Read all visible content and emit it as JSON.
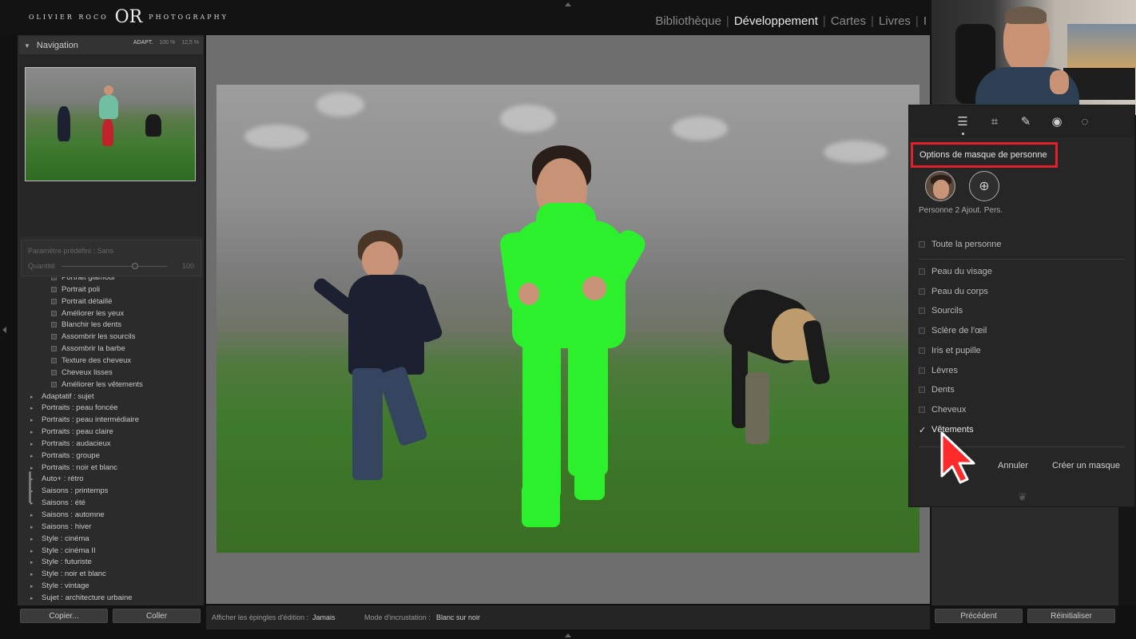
{
  "header": {
    "logo_left": "OLIVIER ROCO",
    "logo_monogram": "OR",
    "logo_right": "PHOTOGRAPHY",
    "modules": [
      {
        "label": "Bibliothèque",
        "active": false
      },
      {
        "label": "Développement",
        "active": true
      },
      {
        "label": "Cartes",
        "active": false
      },
      {
        "label": "Livres",
        "active": false
      },
      {
        "label": "I",
        "active": false
      }
    ],
    "separator": "|"
  },
  "navigator": {
    "title": "Navigation",
    "zoom_options": [
      "ADAPT.",
      "100 %",
      "12,5 %"
    ]
  },
  "preset_panel": {
    "preset_label": "Paramètre prédéfini : Sans",
    "amount_label": "Quantité",
    "amount_value": "100",
    "amount_fraction": 0.7
  },
  "preset_items": [
    "Portrait glamour",
    "Portrait poli",
    "Portrait détaillé",
    "Améliorer les yeux",
    "Blanchir les dents",
    "Assombrir les sourcils",
    "Assombrir la barbe",
    "Texture des cheveux",
    "Cheveux lisses",
    "Améliorer les vêtements"
  ],
  "preset_groups": [
    "Adaptatif : sujet",
    "Portraits : peau foncée",
    "Portraits : peau intermédiaire",
    "Portraits : peau claire",
    "Portraits : audacieux",
    "Portraits : groupe",
    "Portraits : noir et blanc",
    "Auto+ : rétro",
    "Saisons : printemps",
    "Saisons : été",
    "Saisons : automne",
    "Saisons : hiver",
    "Style : cinéma",
    "Style : cinéma II",
    "Style : futuriste",
    "Style : noir et blanc",
    "Style : vintage",
    "Sujet : architecture urbaine"
  ],
  "left_buttons": {
    "copy": "Copier...",
    "paste": "Coller"
  },
  "toolbar": {
    "pins_label": "Afficher les épingles d'édition :",
    "pins_value": "Jamais",
    "overlay_label": "Mode d'incrustation :",
    "overlay_value": "Blanc sur noir"
  },
  "mask_panel": {
    "title": "Options de masque de personne",
    "person_label": "Personne 2 Ajout. Pers.",
    "whole_person": {
      "label": "Toute la personne",
      "checked": false
    },
    "options": [
      {
        "label": "Peau du visage",
        "checked": false
      },
      {
        "label": "Peau du corps",
        "checked": false
      },
      {
        "label": "Sourcils",
        "checked": false
      },
      {
        "label": "Sclère de l'œil",
        "checked": false
      },
      {
        "label": "Iris et pupille",
        "checked": false
      },
      {
        "label": "Lèvres",
        "checked": false
      },
      {
        "label": "Dents",
        "checked": false
      },
      {
        "label": "Cheveux",
        "checked": false
      },
      {
        "label": "Vêtements",
        "checked": true
      }
    ],
    "cancel_label": "Annuler",
    "create_label": "Créer un masque",
    "check_glyph": "✓"
  },
  "right_buttons": {
    "previous": "Précédent",
    "reset": "Réinitialiser"
  },
  "colors": {
    "mask_overlay": "#2cf02c",
    "highlight_border": "#e0202a",
    "cursor": "#e0202a"
  }
}
